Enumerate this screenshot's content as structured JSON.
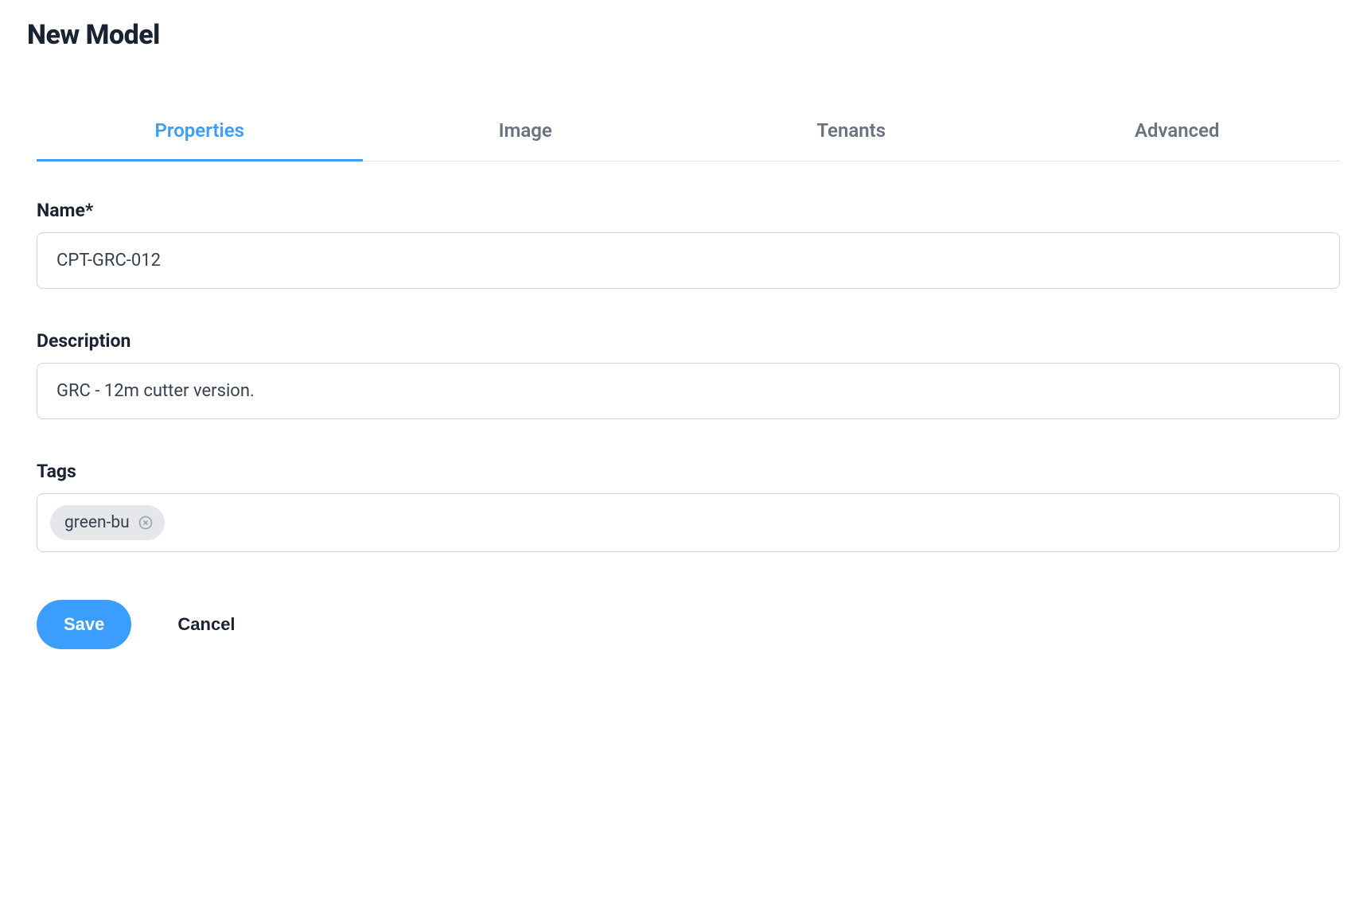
{
  "page": {
    "title": "New Model"
  },
  "tabs": [
    {
      "label": "Properties",
      "active": true
    },
    {
      "label": "Image",
      "active": false
    },
    {
      "label": "Tenants",
      "active": false
    },
    {
      "label": "Advanced",
      "active": false
    }
  ],
  "form": {
    "name": {
      "label": "Name*",
      "value": "CPT-GRC-012"
    },
    "description": {
      "label": "Description",
      "value": "GRC - 12m cutter version."
    },
    "tags": {
      "label": "Tags",
      "items": [
        {
          "text": "green-bu"
        }
      ]
    }
  },
  "actions": {
    "save": "Save",
    "cancel": "Cancel"
  }
}
